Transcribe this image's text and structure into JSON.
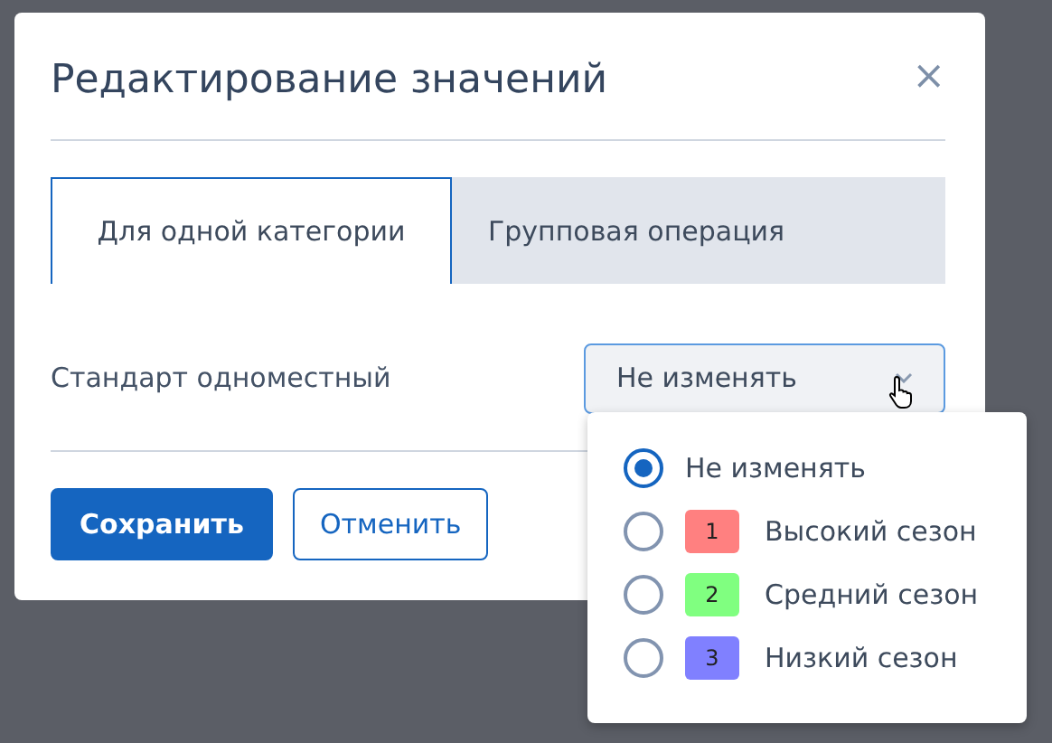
{
  "dialog": {
    "title": "Редактирование значений",
    "close": "×"
  },
  "tabs": [
    {
      "label": "Для одной категории",
      "selected": true
    },
    {
      "label": "Групповая операция",
      "selected": false
    }
  ],
  "field": {
    "label": "Стандарт одноместный",
    "value": "Не изменять",
    "expanded": true
  },
  "options": [
    {
      "label": "Не изменять",
      "selected": true
    },
    {
      "label": "Высокий сезон",
      "selected": false,
      "badge": "1",
      "color": "#ff8080"
    },
    {
      "label": "Средний сезон",
      "selected": false,
      "badge": "2",
      "color": "#80ff80"
    },
    {
      "label": "Низкий сезон",
      "selected": false,
      "badge": "3",
      "color": "#8080ff"
    }
  ],
  "buttons": [
    {
      "label": "Сохранить",
      "kind": "primary"
    },
    {
      "label": "Отменить",
      "kind": "secondary"
    }
  ]
}
